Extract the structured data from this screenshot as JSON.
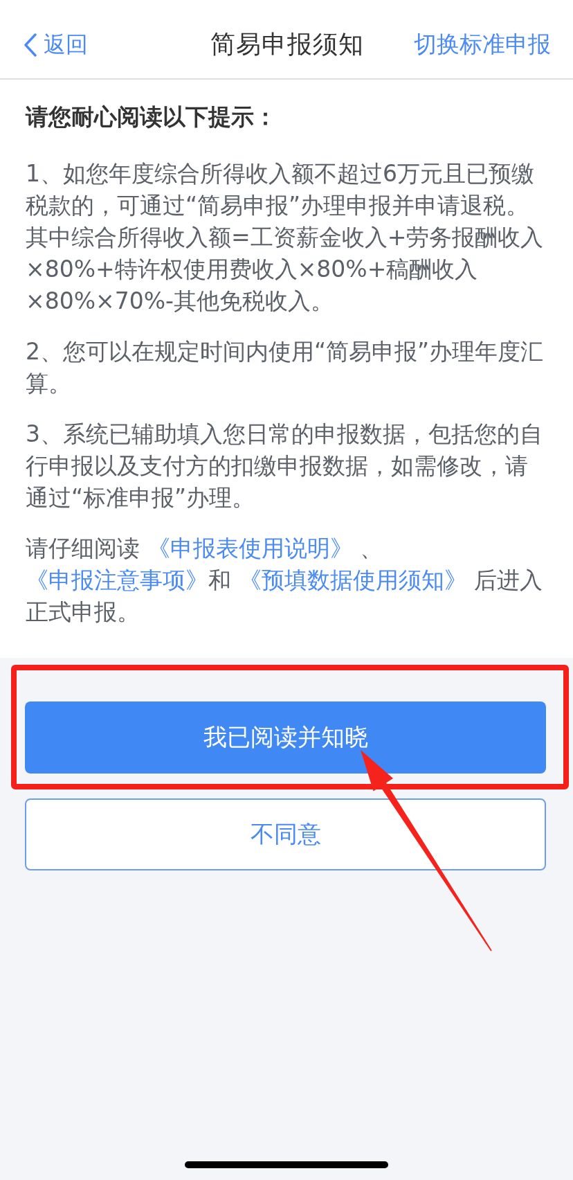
{
  "nav_bar": {
    "back": {
      "label": "返回"
    },
    "title": "简易申报须知",
    "action": {
      "label": "切换标准申报"
    }
  },
  "notice": {
    "heading": "请您耐心阅读以下提示：",
    "paragraphs": [
      "1、如您年度综合所得收入额不超过6万元且已预缴税款的，可通过“简易申报”办理申报并申请退税。其中综合所得收入额=工资薪金收入+劳务报酬收入×80%+特许权使用费收入×80%+稿酬收入×80%×70%-其他免税收入。",
      "2、您可以在规定时间内使用“简易申报”办理年度汇算。",
      "3、系统已辅助填入您日常的申报数据，包括您的自行申报以及支付方的扣缴申报数据，如需修改，请通过“标准申报”办理。"
    ],
    "closing": [
      {
        "kind": "text",
        "text": "请仔细阅读 "
      },
      {
        "kind": "link",
        "text": "《申报表使用说明》"
      },
      {
        "kind": "text",
        "text": " 、 "
      },
      {
        "kind": "link",
        "text": "《申报注意事项》"
      },
      {
        "kind": "text",
        "text": "和 "
      },
      {
        "kind": "link",
        "text": "《预填数据使用须知》"
      },
      {
        "kind": "text",
        "text": " 后进入正式申报。"
      }
    ]
  },
  "buttons": [
    {
      "label": "我已阅读并知晓",
      "kind": "primary",
      "highlighted": true
    },
    {
      "label": "不同意",
      "kind": "secondary",
      "highlighted": false
    }
  ]
}
